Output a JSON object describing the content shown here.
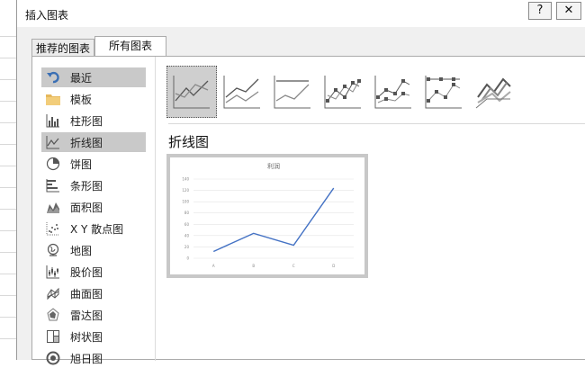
{
  "dialog": {
    "title": "插入图表",
    "help_label": "?",
    "close_label": "✕"
  },
  "tabs": [
    {
      "label": "推荐的图表",
      "selected": false
    },
    {
      "label": "所有图表",
      "selected": true
    }
  ],
  "sidebar": {
    "items": [
      {
        "label": "最近",
        "icon": "undo-arrow-icon",
        "selected": true
      },
      {
        "label": "模板",
        "icon": "folder-icon",
        "selected": false
      },
      {
        "label": "柱形图",
        "icon": "column-chart-icon",
        "selected": false
      },
      {
        "label": "折线图",
        "icon": "line-chart-icon",
        "selected": true
      },
      {
        "label": "饼图",
        "icon": "pie-chart-icon",
        "selected": false
      },
      {
        "label": "条形图",
        "icon": "bar-chart-icon",
        "selected": false
      },
      {
        "label": "面积图",
        "icon": "area-chart-icon",
        "selected": false
      },
      {
        "label": "X Y 散点图",
        "icon": "scatter-chart-icon",
        "selected": false
      },
      {
        "label": "地图",
        "icon": "globe-map-icon",
        "selected": false
      },
      {
        "label": "股价图",
        "icon": "stock-chart-icon",
        "selected": false
      },
      {
        "label": "曲面图",
        "icon": "surface-chart-icon",
        "selected": false
      },
      {
        "label": "雷达图",
        "icon": "radar-chart-icon",
        "selected": false
      },
      {
        "label": "树状图",
        "icon": "treemap-chart-icon",
        "selected": false
      },
      {
        "label": "旭日图",
        "icon": "sunburst-chart-icon",
        "selected": false
      }
    ]
  },
  "chart_types": [
    {
      "icon": "line-icon",
      "selected": true
    },
    {
      "icon": "stacked-line-icon",
      "selected": false
    },
    {
      "icon": "percent-stacked-line-icon",
      "selected": false
    },
    {
      "icon": "line-with-markers-icon",
      "selected": false
    },
    {
      "icon": "stacked-line-with-markers-icon",
      "selected": false
    },
    {
      "icon": "percent-stacked-line-with-markers-icon",
      "selected": false
    },
    {
      "icon": "3d-line-icon",
      "selected": false
    }
  ],
  "section_title": "折线图",
  "accent_color": "#4472c4",
  "chart_data": {
    "type": "line",
    "title": "利润",
    "categories": [
      "A",
      "B",
      "C",
      "D"
    ],
    "series": [
      {
        "values": [
          12,
          44,
          23,
          124
        ]
      }
    ],
    "yticks": [
      "0",
      "20",
      "40",
      "60",
      "80",
      "100",
      "120",
      "140"
    ],
    "ylim": [
      0,
      140
    ],
    "grid": true,
    "legend": "none"
  }
}
